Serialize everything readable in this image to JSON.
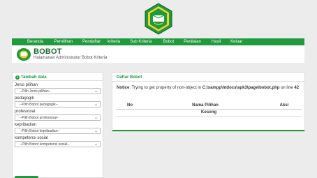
{
  "nav": {
    "items": [
      "Beranda",
      "Pemilihan",
      "Pendaftar",
      "kriteria",
      "Sub Kriteria",
      "Bobot",
      "Penilaian",
      "Hasil",
      "Keluar"
    ]
  },
  "header": {
    "title": "BOBOT",
    "subtitle": "Halamanan Administrator Bobot Kriteria"
  },
  "form": {
    "title": "Tambah data",
    "fields": [
      {
        "label": "Jenis pilihan",
        "value": "--Pilih Jenis pilihan--"
      },
      {
        "label": "pedagogik",
        "value": "--Pilih Bobot pedagogik--"
      },
      {
        "label": "profesional",
        "value": "--Pilih Bobot profesional--"
      },
      {
        "label": "kepribadian",
        "value": "--Pilih Bobot kepribadian--"
      },
      {
        "label": "kompetensi sosial",
        "value": "--Pilih Bobot kompetensi sosial--"
      }
    ]
  },
  "list": {
    "title": "Daftar Bobot",
    "notice_label": "Notice",
    "notice_text": ": Trying to get property of non-object in ",
    "notice_path": "C:\\xampp\\htdocs\\spk3\\page\\bobot.php",
    "notice_on": " on line ",
    "notice_line": "42",
    "columns": [
      "No",
      "Nama Pilihan",
      "Aksi"
    ],
    "empty_text": "Kosong"
  },
  "colors": {
    "accent": "#1f9a3c",
    "header_text": "#1b6b30"
  }
}
